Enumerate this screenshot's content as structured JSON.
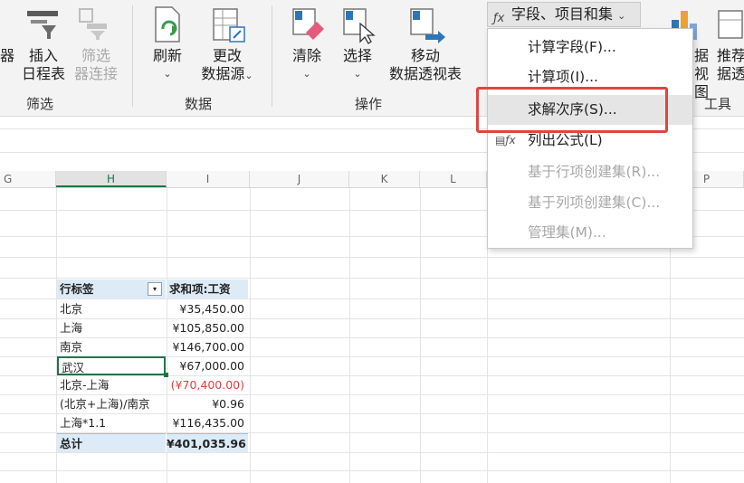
{
  "ribbon": {
    "insert_timeline": [
      "插入",
      "日程表"
    ],
    "filter_connections": [
      "筛选",
      "器连接"
    ],
    "left_cut_char": "器",
    "refresh": "刷新",
    "change_source": [
      "更改",
      "数据源"
    ],
    "clear": "清除",
    "select": "选择",
    "move_pivot": [
      "移动",
      "数据透视表"
    ],
    "fields_items_sets": "字段、项目和集",
    "recommend_cut": [
      "推荐",
      "据透"
    ],
    "chart_cut": [
      "据",
      "视图"
    ],
    "caret": "⌄",
    "groups": {
      "filter": "筛选",
      "data": "数据",
      "actions": "操作",
      "tools": "工具"
    }
  },
  "menu": {
    "items": [
      {
        "label": "计算字段(F)...",
        "enabled": true
      },
      {
        "label": "计算项(I)...",
        "enabled": true
      },
      {
        "label": "求解次序(S)...",
        "enabled": true,
        "highlighted": true
      },
      {
        "label": "列出公式(L)",
        "enabled": true
      },
      {
        "label": "基于行项创建集(R)...",
        "enabled": false
      },
      {
        "label": "基于列项创建集(C)...",
        "enabled": false
      },
      {
        "label": "管理集(M)...",
        "enabled": false
      }
    ]
  },
  "columns": [
    "G",
    "H",
    "I",
    "J",
    "K",
    "L",
    "P"
  ],
  "pivot": {
    "header_label": "行标签",
    "header_value": "求和项:工资",
    "rows": [
      {
        "label": "北京",
        "value": "¥35,450.00"
      },
      {
        "label": "上海",
        "value": "¥105,850.00"
      },
      {
        "label": "南京",
        "value": "¥146,700.00"
      },
      {
        "label": "武汉",
        "value": "¥67,000.00"
      },
      {
        "label": "北京-上海",
        "value": "(¥70,400.00)"
      },
      {
        "label": "(北京+上海)/南京",
        "value": "¥0.96"
      },
      {
        "label": "上海*1.1",
        "value": "¥116,435.00"
      }
    ],
    "total_label": "总计",
    "total_value": "¥401,035.96"
  },
  "colors": {
    "accent_green": "#217346",
    "highlight_red": "#e0453f",
    "pivot_header": "#ddebf7",
    "negative": "#e04040"
  }
}
